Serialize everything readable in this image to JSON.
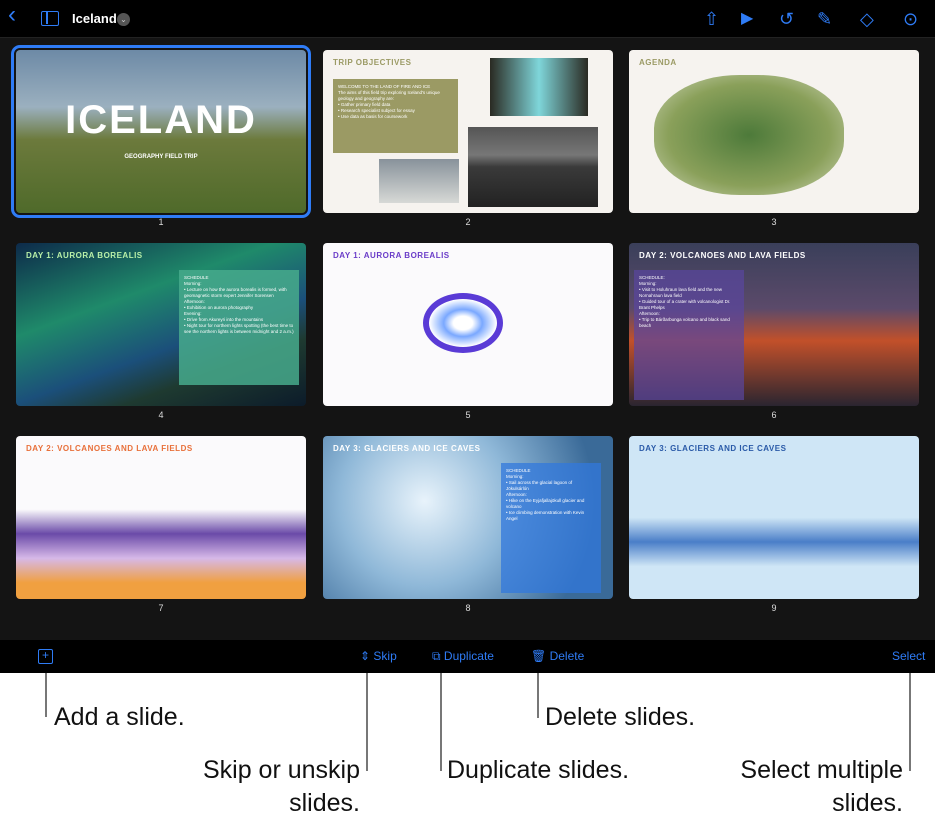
{
  "toolbar": {
    "back": "‹",
    "title": "Iceland",
    "title_menu": "⌄",
    "icons": [
      "back-icon",
      "sidebar-icon",
      "share-icon",
      "play-icon",
      "undo-icon",
      "format-brush-icon",
      "animate-icon",
      "more-icon"
    ]
  },
  "slides": [
    {
      "number": "1",
      "title": "ICELAND",
      "subtitle": "GEOGRAPHY FIELD TRIP"
    },
    {
      "number": "2",
      "title": "TRIP OBJECTIVES",
      "box": "WELCOME TO THE LAND OF FIRE AND ICE\nThe aims of this field trip exploring Iceland's unique geology and geography are:\n• Gather primary field data\n• Research specialist subject for essay\n• Use data as basis for coursework"
    },
    {
      "number": "3",
      "title": "AGENDA"
    },
    {
      "number": "4",
      "title": "DAY 1: AURORA BOREALIS",
      "box": "SCHEDULE\nMorning:\n• Lecture on how the aurora borealis is formed, with geomagnetic storm expert Jennifer Sorensen\nAfternoon:\n• Exhibition on aurora photography\nEvening:\n• Drive from Akureyri into the mountains\n• Night tour for northern lights spotting (the best time to see the northern lights is between midnight and 2 a.m.)"
    },
    {
      "number": "5",
      "title": "DAY 1: AURORA BOREALIS"
    },
    {
      "number": "6",
      "title": "DAY 2: VOLCANOES AND LAVA FIELDS",
      "box": "SCHEDULE:\nMorning:\n• Visit to Holuhraun lava field and the new Nornahraun lava field\n• Guided tour of a crater with volcanologist Dr. Brant Phelps\nAfternoon:\n• Trip to Bárðarbunga volcano and black sand beach"
    },
    {
      "number": "7",
      "title": "DAY 2: VOLCANOES AND LAVA FIELDS"
    },
    {
      "number": "8",
      "title": "DAY 3: GLACIERS AND ICE CAVES",
      "box": "SCHEDULE\nMorning:\n• Sail across the glacial lagoon of Jökulsárlón\nAfternoon:\n• Hike on the Eyjafjallajökull glacier and volcano\n• Ice climbing demonstration with Kevin Angel"
    },
    {
      "number": "9",
      "title": "DAY 3: GLACIERS AND ICE CAVES"
    }
  ],
  "bottombar": {
    "add_icon": "plus-square-icon",
    "skip": "Skip",
    "duplicate": "Duplicate",
    "delete": "Delete",
    "select": "Select"
  },
  "callouts": {
    "add": "Add a slide.",
    "skip_1": "Skip or unskip",
    "skip_2": "slides.",
    "duplicate": "Duplicate slides.",
    "delete": "Delete slides.",
    "select_1": "Select multiple",
    "select_2": "slides."
  },
  "colors": {
    "accent": "#2f7cf6"
  }
}
